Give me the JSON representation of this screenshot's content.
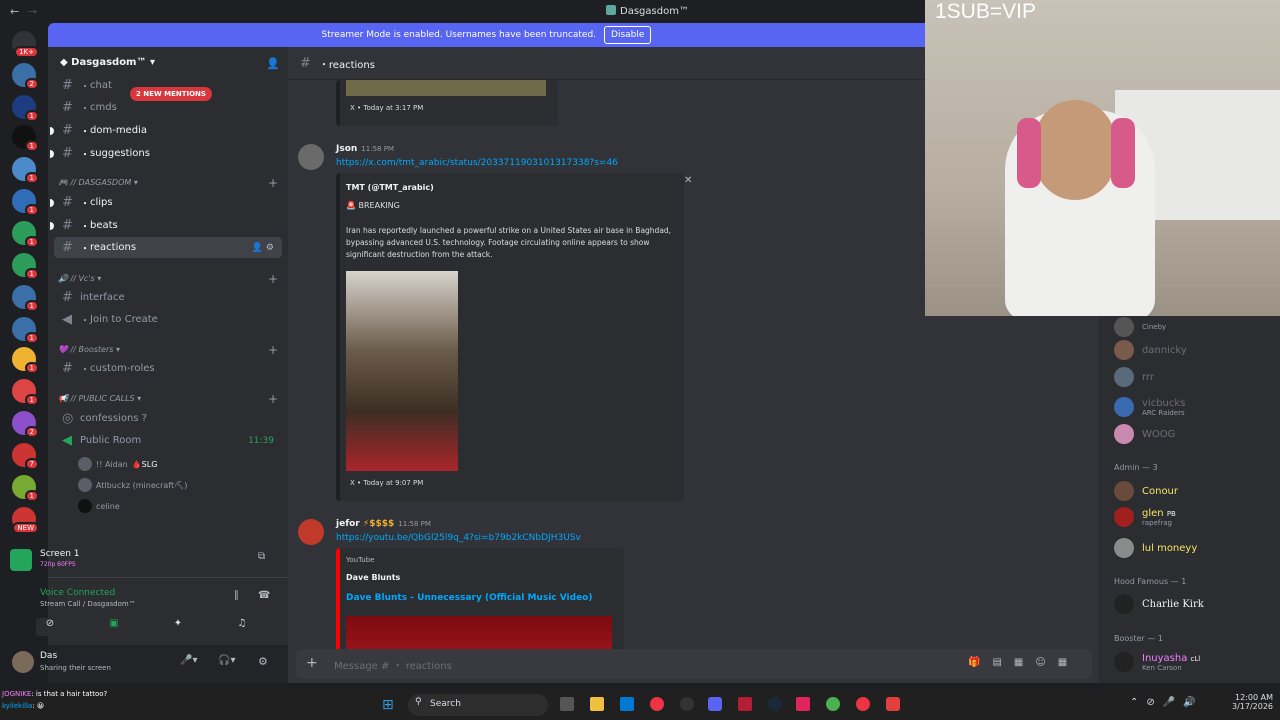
{
  "window": {
    "title": "Dasgasdom™",
    "nav_back": "←",
    "nav_fwd": "→"
  },
  "banner": {
    "text": "Streamer Mode is enabled. Usernames have been truncated.",
    "button": "Disable"
  },
  "guild_badges": [
    "1K+",
    "2",
    "1",
    "1",
    "1",
    "1",
    "1",
    "1",
    "1",
    "1",
    "1",
    "1",
    "2",
    "7",
    "1",
    "2",
    "NEW"
  ],
  "sidebar": {
    "server_name": "Dasgasdom™",
    "mentions_pill": "2 NEW MENTIONS",
    "channels_top": [
      "chat",
      "cmds",
      "dom-media",
      "suggestions"
    ],
    "cat_dasgasdom": "// DASGASDOM",
    "channels_dasgasdom": [
      "clips",
      "beats",
      "reactions"
    ],
    "cat_vcs": "// Vc's",
    "channels_vcs": [
      "interface",
      "Join to Create"
    ],
    "cat_boosters": "// Boosters",
    "channels_boosters": [
      "custom-roles"
    ],
    "cat_public": "// PUBLIC CALLS",
    "channels_public": [
      "confessions ?",
      "Public Room"
    ],
    "public_room_time": "11:39",
    "voice_users": [
      "!! Aidan",
      "Atlbuckz (minecraft⛏)",
      "celine"
    ],
    "voice_user_tag": "SLG",
    "screen": {
      "title": "Screen 1",
      "sub": "720p 60FPS"
    },
    "voice": {
      "status": "Voice Connected",
      "channel": "Stream Call / Dasgasdom™"
    },
    "user": {
      "name": "Das",
      "status": "Sharing their screen"
    }
  },
  "main": {
    "channel": "reactions",
    "embed_top_footer": "X • Today at 3:17 PM",
    "msg1": {
      "author": "Json",
      "time": "11:58 PM",
      "link": "https://x.com/tmt_arabic/status/2033711903101317338?s=46",
      "embed_author": "TMT (@TMT_arabic)",
      "embed_tag": "🚨 BREAKING",
      "embed_text": "Iran has reportedly launched a powerful strike on a United States air base in Baghdad, bypassing advanced U.S. technology. Footage circulating online appears to show significant destruction from the attack.",
      "embed_footer": "X • Today at 9:07 PM"
    },
    "msg2": {
      "author": "jefor",
      "badge": "⚡$$$$",
      "time": "11:58 PM",
      "link": "https://youtu.be/QbGl25l9q_4?si=b79b2kCNbDJH3USv",
      "provider": "YouTube",
      "channel_name": "Dave Blunts",
      "video_title": "Dave Blunts - Unnecessary (Official Music Video)"
    },
    "composer_placeholder": "Message # ・ reactions"
  },
  "members": {
    "top_entries": [
      {
        "name": "",
        "sub": "Cineby"
      },
      {
        "name": "dannicky",
        "sub": ""
      },
      {
        "name": "rrr",
        "sub": ""
      },
      {
        "name": "vicbucks",
        "sub": "ARC Raiders"
      },
      {
        "name": "WOOG",
        "sub": ""
      }
    ],
    "admin_header": "Admin — 3",
    "admins": [
      {
        "name": "Conour",
        "sub": "",
        "color": "#f5e663"
      },
      {
        "name": "glen",
        "sub": "rapefrag",
        "color": "#f5e663",
        "tag": "PB"
      },
      {
        "name": "lul moneyy",
        "sub": "",
        "color": "#f5e663"
      }
    ],
    "hood_header": "Hood Famous — 1",
    "hood": [
      {
        "name": "Charlie Kirk",
        "sub": "",
        "color": "#f2f3f5"
      }
    ],
    "booster_header": "Booster — 1",
    "boosters": [
      {
        "name": "Inuyasha",
        "sub": "Ken Carson",
        "color": "#f47fff",
        "tag": "cLl"
      }
    ]
  },
  "webcam": {
    "label": "1SUB=VIP"
  },
  "taskbar": {
    "search": "Search",
    "time": "12:00 AM",
    "date": "3/17/2026"
  },
  "stream_chat": [
    {
      "user": "JOGNIKE",
      "text": "is that a hair tattoo?"
    },
    {
      "user": "kyliekilla",
      "text": "😀"
    }
  ]
}
